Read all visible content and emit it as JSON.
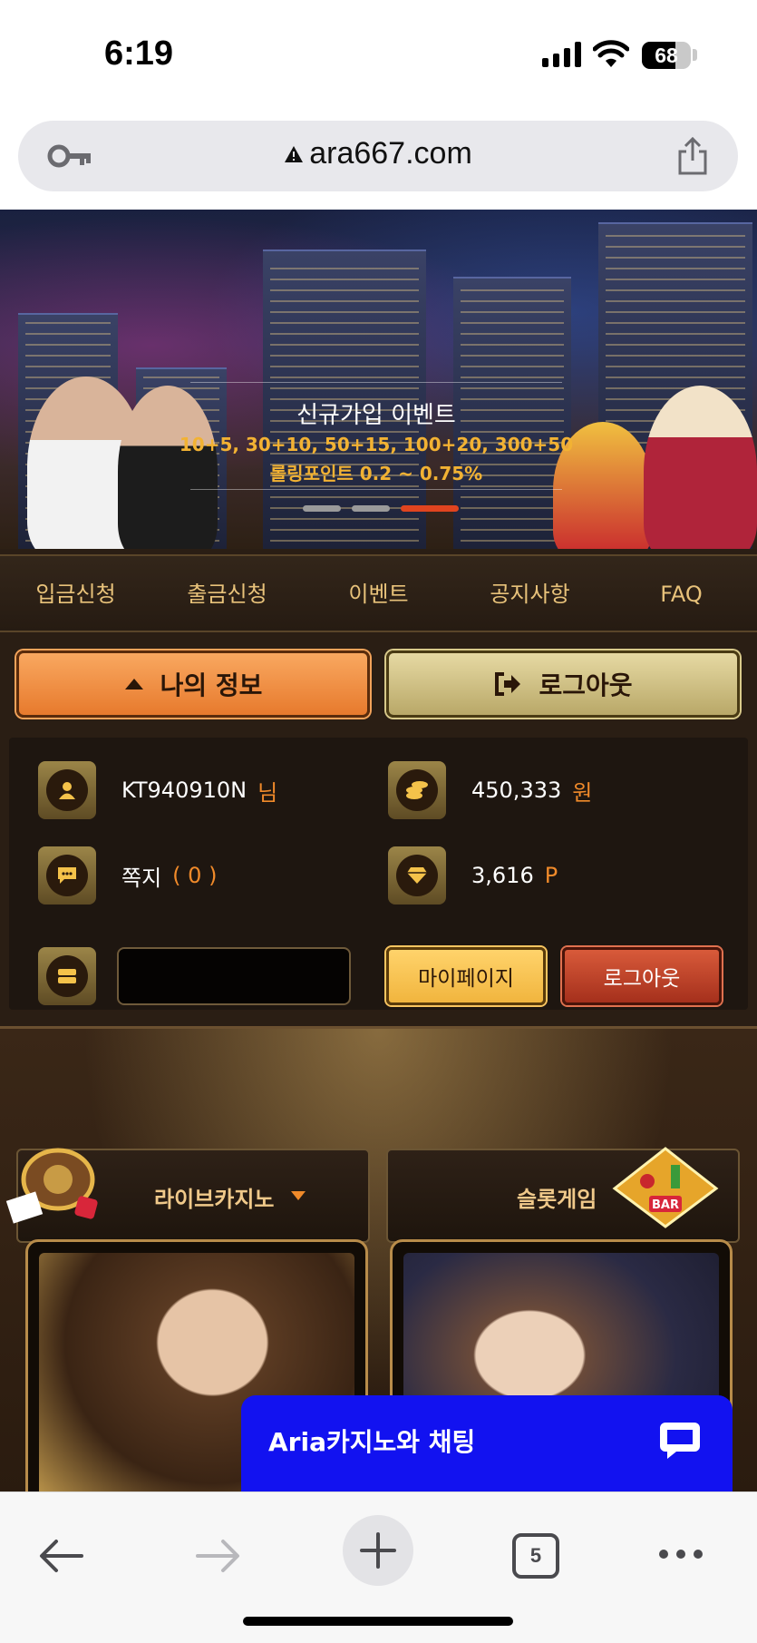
{
  "status_bar": {
    "time": "6:19",
    "battery": "68",
    "battery_level": 0.68
  },
  "browser": {
    "url": "ara667.com",
    "tab_count": "5"
  },
  "banner": {
    "title": "신규가입 이벤트",
    "line1": "10+5, 30+10, 50+15, 100+20, 300+50",
    "line2": "롤링포인트 0.2 ~ 0.75%",
    "slide_count": 3,
    "active_slide": 3
  },
  "nav": [
    "입금신청",
    "출금신청",
    "이벤트",
    "공지사항",
    "FAQ"
  ],
  "buttons": {
    "my_info": "나의 정보",
    "logout": "로그아웃"
  },
  "account": {
    "username": "KT940910N",
    "username_suffix": "님",
    "balance": "450,333",
    "balance_unit": "원",
    "messages_label": "쪽지",
    "messages_count": "( 0 )",
    "points": "3,616",
    "points_unit": "P",
    "mypage_button": "마이페이지",
    "logout_button": "로그아웃"
  },
  "game_tabs": {
    "live_casino": "라이브카지노",
    "slot": "슬롯게임"
  },
  "chat": {
    "label": "Aria카지노와 채팅"
  },
  "colors": {
    "accent_orange": "#f08a2a",
    "nav_gold": "#e8c27a",
    "chat_blue": "#1212f0"
  }
}
